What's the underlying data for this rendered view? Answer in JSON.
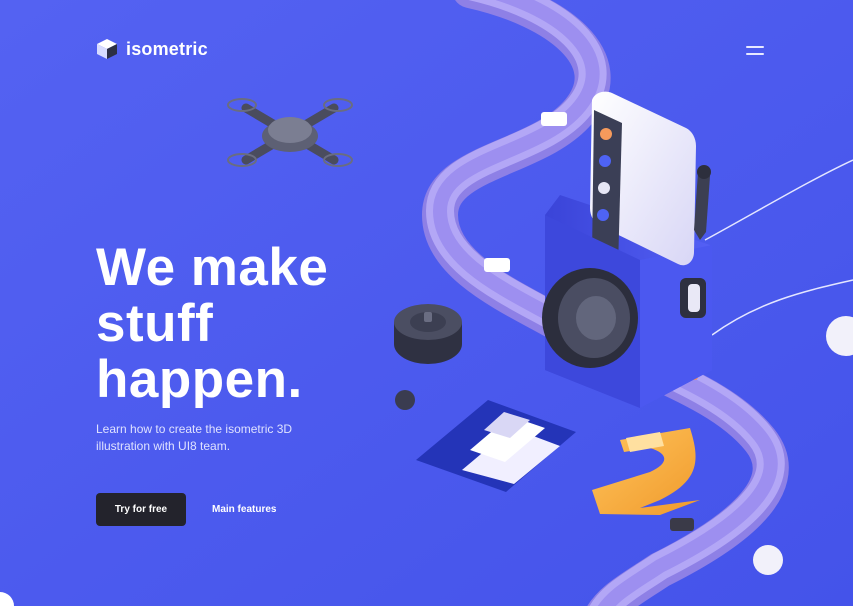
{
  "brand": {
    "name": "isometric",
    "logo_icon": "cube-icon"
  },
  "header": {
    "menu_icon": "hamburger-menu-icon"
  },
  "hero": {
    "headline_lines": [
      "We make",
      "stuff",
      "happen."
    ],
    "subtext_lines": [
      "Learn how to create the isometric 3D",
      "illustration with UI8 team."
    ]
  },
  "actions": {
    "primary_label": "Try for free",
    "secondary_label": "Main features"
  },
  "colors": {
    "background": "#4f5df0",
    "primary_button": "#23232c",
    "track": "#a79bf0",
    "accent_orange": "#f5a43a"
  }
}
